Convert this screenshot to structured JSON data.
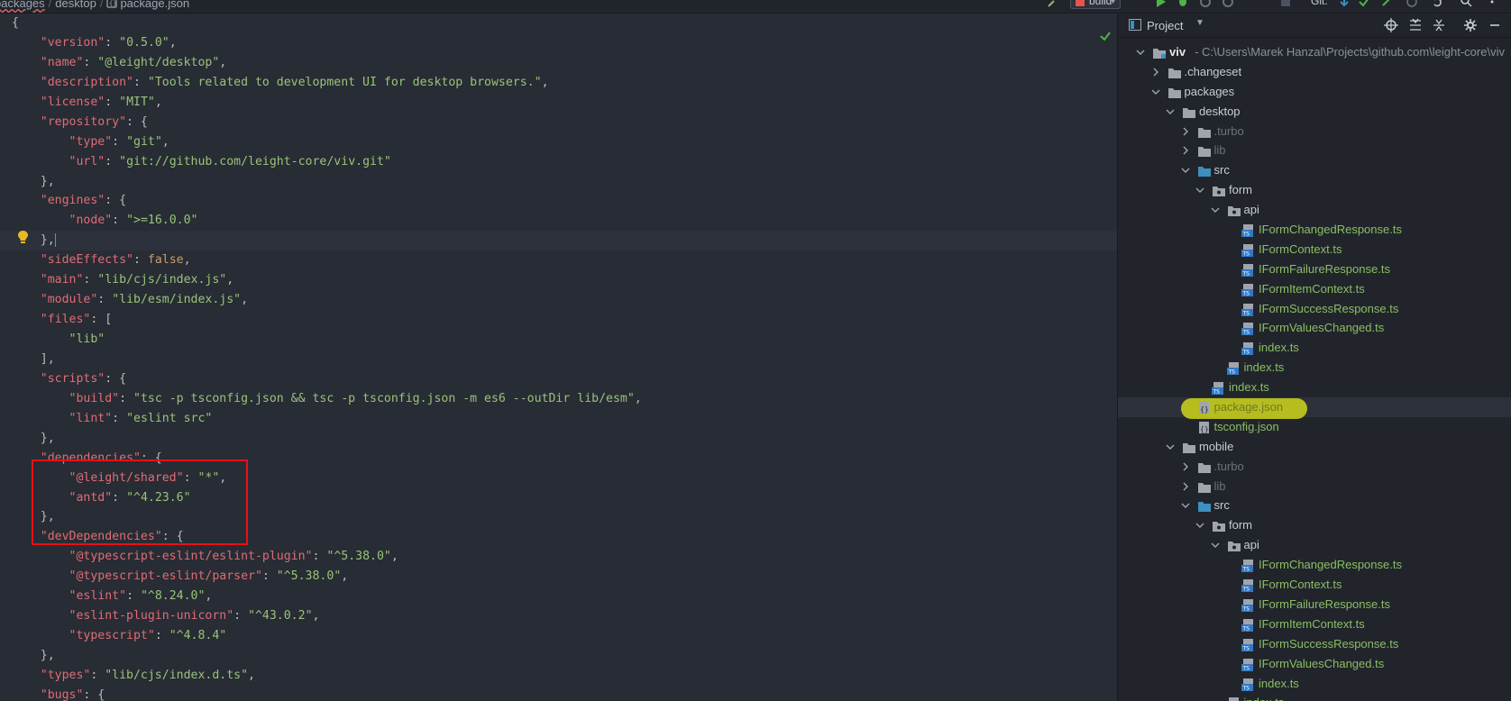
{
  "breadcrumb": [
    "packages",
    "desktop",
    "package.json"
  ],
  "toolbar": {
    "run_config": "build",
    "git_label": "Git:"
  },
  "editor": {
    "lines": [
      [
        [
          "p",
          "{"
        ]
      ],
      [
        [
          "p",
          "    "
        ],
        [
          "k",
          "\"version\""
        ],
        [
          "p",
          ": "
        ],
        [
          "s",
          "\"0.5.0\""
        ],
        [
          "p",
          ","
        ]
      ],
      [
        [
          "p",
          "    "
        ],
        [
          "k",
          "\"name\""
        ],
        [
          "p",
          ": "
        ],
        [
          "s",
          "\"@leight/desktop\""
        ],
        [
          "p",
          ","
        ]
      ],
      [
        [
          "p",
          "    "
        ],
        [
          "k",
          "\"description\""
        ],
        [
          "p",
          ": "
        ],
        [
          "s",
          "\"Tools related to development UI for desktop browsers.\""
        ],
        [
          "p",
          ","
        ]
      ],
      [
        [
          "p",
          "    "
        ],
        [
          "k",
          "\"license\""
        ],
        [
          "p",
          ": "
        ],
        [
          "s",
          "\"MIT\""
        ],
        [
          "p",
          ","
        ]
      ],
      [
        [
          "p",
          "    "
        ],
        [
          "k",
          "\"repository\""
        ],
        [
          "p",
          ": {"
        ]
      ],
      [
        [
          "p",
          "        "
        ],
        [
          "k",
          "\"type\""
        ],
        [
          "p",
          ": "
        ],
        [
          "s",
          "\"git\""
        ],
        [
          "p",
          ","
        ]
      ],
      [
        [
          "p",
          "        "
        ],
        [
          "k",
          "\"url\""
        ],
        [
          "p",
          ": "
        ],
        [
          "s",
          "\"git://github.com/leight-core/viv.git\""
        ]
      ],
      [
        [
          "p",
          "    },"
        ]
      ],
      [
        [
          "p",
          "    "
        ],
        [
          "k",
          "\"engines\""
        ],
        [
          "p",
          ": {"
        ]
      ],
      [
        [
          "p",
          "        "
        ],
        [
          "k",
          "\"node\""
        ],
        [
          "p",
          ": "
        ],
        [
          "s",
          "\">=16.0.0\""
        ]
      ],
      [
        [
          "p",
          "    },"
        ]
      ],
      [
        [
          "p",
          "    "
        ],
        [
          "k",
          "\"sideEffects\""
        ],
        [
          "p",
          ": "
        ],
        [
          "b",
          "false"
        ],
        [
          "p",
          ","
        ]
      ],
      [
        [
          "p",
          "    "
        ],
        [
          "k",
          "\"main\""
        ],
        [
          "p",
          ": "
        ],
        [
          "s",
          "\"lib/cjs/index.js\""
        ],
        [
          "p",
          ","
        ]
      ],
      [
        [
          "p",
          "    "
        ],
        [
          "k",
          "\"module\""
        ],
        [
          "p",
          ": "
        ],
        [
          "s",
          "\"lib/esm/index.js\""
        ],
        [
          "p",
          ","
        ]
      ],
      [
        [
          "p",
          "    "
        ],
        [
          "k",
          "\"files\""
        ],
        [
          "p",
          ": ["
        ]
      ],
      [
        [
          "p",
          "        "
        ],
        [
          "s",
          "\"lib\""
        ]
      ],
      [
        [
          "p",
          "    ],"
        ]
      ],
      [
        [
          "p",
          "    "
        ],
        [
          "k",
          "\"scripts\""
        ],
        [
          "p",
          ": {"
        ]
      ],
      [
        [
          "p",
          "        "
        ],
        [
          "k",
          "\"build\""
        ],
        [
          "p",
          ": "
        ],
        [
          "s",
          "\"tsc -p tsconfig.json && tsc -p tsconfig.json -m es6 --outDir lib/esm\""
        ],
        [
          "p",
          ","
        ]
      ],
      [
        [
          "p",
          "        "
        ],
        [
          "k",
          "\"lint\""
        ],
        [
          "p",
          ": "
        ],
        [
          "s",
          "\"eslint src\""
        ]
      ],
      [
        [
          "p",
          "    },"
        ]
      ],
      [
        [
          "p",
          "    "
        ],
        [
          "k",
          "\"dependencies\""
        ],
        [
          "p",
          ": {"
        ]
      ],
      [
        [
          "p",
          "        "
        ],
        [
          "k",
          "\"@leight/shared\""
        ],
        [
          "p",
          ": "
        ],
        [
          "s",
          "\"*\""
        ],
        [
          "p",
          ","
        ]
      ],
      [
        [
          "p",
          "        "
        ],
        [
          "k",
          "\"antd\""
        ],
        [
          "p",
          ": "
        ],
        [
          "s",
          "\"^4.23.6\""
        ]
      ],
      [
        [
          "p",
          "    },"
        ]
      ],
      [
        [
          "p",
          "    "
        ],
        [
          "k",
          "\"devDependencies\""
        ],
        [
          "p",
          ": {"
        ]
      ],
      [
        [
          "p",
          "        "
        ],
        [
          "k",
          "\"@typescript-eslint/eslint-plugin\""
        ],
        [
          "p",
          ": "
        ],
        [
          "s",
          "\"^5.38.0\""
        ],
        [
          "p",
          ","
        ]
      ],
      [
        [
          "p",
          "        "
        ],
        [
          "k",
          "\"@typescript-eslint/parser\""
        ],
        [
          "p",
          ": "
        ],
        [
          "s",
          "\"^5.38.0\""
        ],
        [
          "p",
          ","
        ]
      ],
      [
        [
          "p",
          "        "
        ],
        [
          "k",
          "\"eslint\""
        ],
        [
          "p",
          ": "
        ],
        [
          "s",
          "\"^8.24.0\""
        ],
        [
          "p",
          ","
        ]
      ],
      [
        [
          "p",
          "        "
        ],
        [
          "k",
          "\"eslint-plugin-unicorn\""
        ],
        [
          "p",
          ": "
        ],
        [
          "s",
          "\"^43.0.2\""
        ],
        [
          "p",
          ","
        ]
      ],
      [
        [
          "p",
          "        "
        ],
        [
          "k",
          "\"typescript\""
        ],
        [
          "p",
          ": "
        ],
        [
          "s",
          "\"^4.8.4\""
        ]
      ],
      [
        [
          "p",
          "    },"
        ]
      ],
      [
        [
          "p",
          "    "
        ],
        [
          "k",
          "\"types\""
        ],
        [
          "p",
          ": "
        ],
        [
          "s",
          "\"lib/cjs/index.d.ts\""
        ],
        [
          "p",
          ","
        ]
      ],
      [
        [
          "p",
          "    "
        ],
        [
          "k",
          "\"bugs\""
        ],
        [
          "p",
          ": {"
        ]
      ]
    ],
    "current_line": 11
  },
  "project_panel": {
    "title": "Project",
    "tree": [
      {
        "depth": 0,
        "arrow": "down",
        "icon": "module-folder",
        "label": "viv",
        "hint": "- C:\\Users\\Marek Hanzal\\Projects\\github.com\\leight-core\\viv",
        "style": "root"
      },
      {
        "depth": 1,
        "arrow": "right",
        "icon": "folder",
        "label": ".changeset",
        "style": "dir"
      },
      {
        "depth": 1,
        "arrow": "down",
        "icon": "folder",
        "label": "packages",
        "style": "dir"
      },
      {
        "depth": 2,
        "arrow": "down",
        "icon": "folder",
        "label": "desktop",
        "style": "dir"
      },
      {
        "depth": 3,
        "arrow": "right",
        "icon": "folder",
        "label": ".turbo",
        "style": "dim"
      },
      {
        "depth": 3,
        "arrow": "right",
        "icon": "folder",
        "label": "lib",
        "style": "dim"
      },
      {
        "depth": 3,
        "arrow": "down",
        "icon": "source-folder",
        "label": "src",
        "style": "dir"
      },
      {
        "depth": 4,
        "arrow": "down",
        "icon": "package-folder",
        "label": "form",
        "style": "dir"
      },
      {
        "depth": 5,
        "arrow": "down",
        "icon": "package-folder",
        "label": "api",
        "style": "dir"
      },
      {
        "depth": 6,
        "arrow": "none",
        "icon": "ts-file",
        "label": "IFormChangedResponse.ts",
        "style": "ts"
      },
      {
        "depth": 6,
        "arrow": "none",
        "icon": "ts-file",
        "label": "IFormContext.ts",
        "style": "ts"
      },
      {
        "depth": 6,
        "arrow": "none",
        "icon": "ts-file",
        "label": "IFormFailureResponse.ts",
        "style": "ts"
      },
      {
        "depth": 6,
        "arrow": "none",
        "icon": "ts-file",
        "label": "IFormItemContext.ts",
        "style": "ts"
      },
      {
        "depth": 6,
        "arrow": "none",
        "icon": "ts-file",
        "label": "IFormSuccessResponse.ts",
        "style": "ts"
      },
      {
        "depth": 6,
        "arrow": "none",
        "icon": "ts-file",
        "label": "IFormValuesChanged.ts",
        "style": "ts"
      },
      {
        "depth": 6,
        "arrow": "none",
        "icon": "ts-file",
        "label": "index.ts",
        "style": "ts"
      },
      {
        "depth": 5,
        "arrow": "none",
        "icon": "ts-file",
        "label": "index.ts",
        "style": "ts"
      },
      {
        "depth": 4,
        "arrow": "none",
        "icon": "ts-file",
        "label": "index.ts",
        "style": "ts"
      },
      {
        "depth": 3,
        "arrow": "none",
        "icon": "json-file",
        "label": "package.json",
        "style": "ts",
        "selected": true,
        "marked": true
      },
      {
        "depth": 3,
        "arrow": "none",
        "icon": "json-file",
        "label": "tsconfig.json",
        "style": "ts"
      },
      {
        "depth": 2,
        "arrow": "down",
        "icon": "folder",
        "label": "mobile",
        "style": "dir"
      },
      {
        "depth": 3,
        "arrow": "right",
        "icon": "folder",
        "label": ".turbo",
        "style": "dim"
      },
      {
        "depth": 3,
        "arrow": "right",
        "icon": "folder",
        "label": "lib",
        "style": "dim"
      },
      {
        "depth": 3,
        "arrow": "down",
        "icon": "source-folder",
        "label": "src",
        "style": "dir"
      },
      {
        "depth": 4,
        "arrow": "down",
        "icon": "package-folder",
        "label": "form",
        "style": "dir"
      },
      {
        "depth": 5,
        "arrow": "down",
        "icon": "package-folder",
        "label": "api",
        "style": "dir"
      },
      {
        "depth": 6,
        "arrow": "none",
        "icon": "ts-file",
        "label": "IFormChangedResponse.ts",
        "style": "ts"
      },
      {
        "depth": 6,
        "arrow": "none",
        "icon": "ts-file",
        "label": "IFormContext.ts",
        "style": "ts"
      },
      {
        "depth": 6,
        "arrow": "none",
        "icon": "ts-file",
        "label": "IFormFailureResponse.ts",
        "style": "ts"
      },
      {
        "depth": 6,
        "arrow": "none",
        "icon": "ts-file",
        "label": "IFormItemContext.ts",
        "style": "ts"
      },
      {
        "depth": 6,
        "arrow": "none",
        "icon": "ts-file",
        "label": "IFormSuccessResponse.ts",
        "style": "ts"
      },
      {
        "depth": 6,
        "arrow": "none",
        "icon": "ts-file",
        "label": "IFormValuesChanged.ts",
        "style": "ts"
      },
      {
        "depth": 6,
        "arrow": "none",
        "icon": "ts-file",
        "label": "index.ts",
        "style": "ts"
      },
      {
        "depth": 5,
        "arrow": "none",
        "icon": "ts-file",
        "label": "index.ts",
        "style": "ts"
      }
    ]
  },
  "colors": {
    "highlight_box": "#e8101a",
    "marker": "#cfd61a",
    "string": "#98c379",
    "key": "#e06c75"
  }
}
